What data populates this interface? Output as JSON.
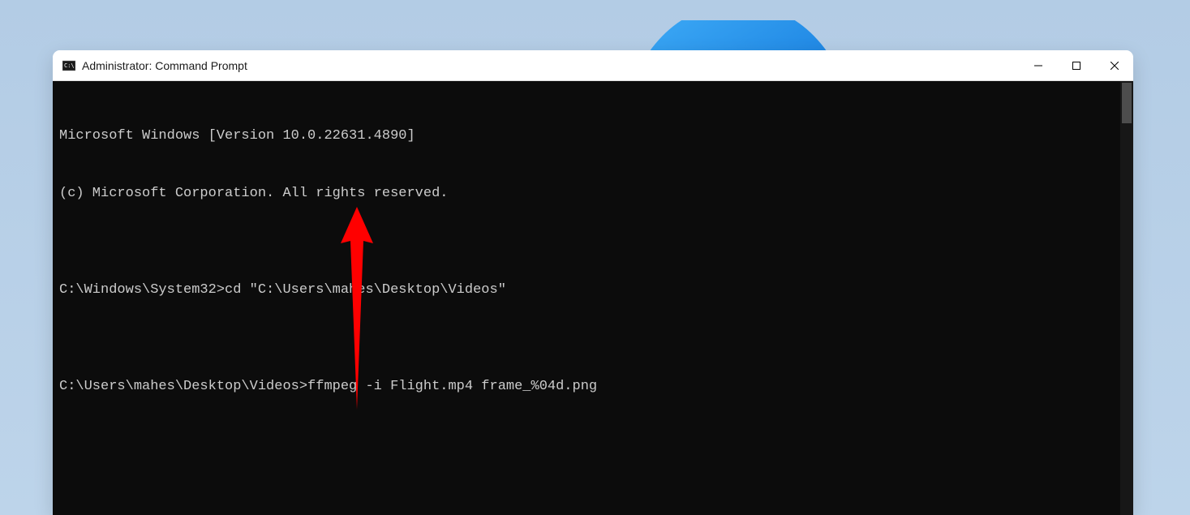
{
  "window": {
    "title": "Administrator: Command Prompt"
  },
  "terminal": {
    "lines": [
      "Microsoft Windows [Version 10.0.22631.4890]",
      "(c) Microsoft Corporation. All rights reserved.",
      "",
      "C:\\Windows\\System32>cd \"C:\\Users\\mahes\\Desktop\\Videos\"",
      "",
      "C:\\Users\\mahes\\Desktop\\Videos>ffmpeg -i Flight.mp4 frame_%04d.png"
    ]
  },
  "annotation": {
    "color": "#ff0000"
  }
}
